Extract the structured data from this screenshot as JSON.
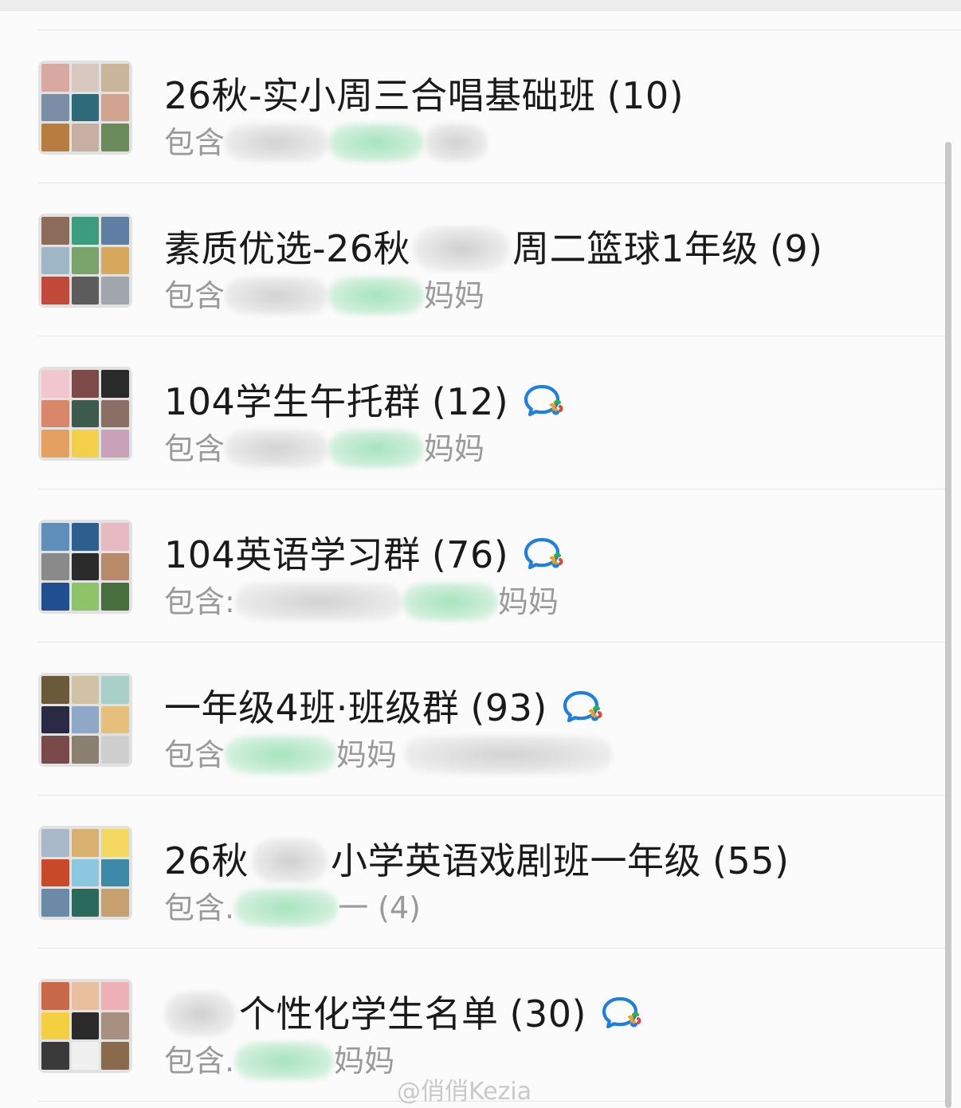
{
  "groups": [
    {
      "title": "26秋-实小周三合唱基础班",
      "count": "(10)",
      "prefix": "包含",
      "suffix": "",
      "tiles": [
        "#d8a9a0",
        "#d9c8c0",
        "#c9b59a",
        "#7a8fa6",
        "#2e6b7a",
        "#d2a48f",
        "#b67d3f",
        "#c7b0a3",
        "#6a8c5b"
      ]
    },
    {
      "title_a": "素质优选-26秋",
      "title_b": "周二篮球1年级",
      "count": "(9)",
      "prefix": "包含",
      "suffix": "妈妈",
      "tiles": [
        "#8b6b5a",
        "#3b9c7e",
        "#5e7fa3",
        "#9fb6c7",
        "#7aa36b",
        "#d7a85a",
        "#c24a3a",
        "#5c5c5c",
        "#9fa7ad"
      ]
    },
    {
      "title": "104学生午托群",
      "count": "(12)",
      "prefix": "包含",
      "suffix": "妈妈",
      "tiles": [
        "#f2c6cf",
        "#7d4b47",
        "#2a2a2a",
        "#d9876b",
        "#3c5a4e",
        "#8c6f64",
        "#e4a060",
        "#f4d04a",
        "#c9a1b9"
      ]
    },
    {
      "title": "104英语学习群",
      "count": "(76)",
      "prefix": "包含:",
      "suffix": "妈妈",
      "tiles": [
        "#5f8fb8",
        "#2d5f8f",
        "#e7b9c2",
        "#8a8a8a",
        "#2b2b2b",
        "#b88a6a",
        "#1f4f8f",
        "#8fc36a",
        "#476e3d"
      ]
    },
    {
      "title": "一年级4班·班级群",
      "count": "(93)",
      "prefix": "包含",
      "suffix": "妈妈",
      "tiles": [
        "#6a5a3a",
        "#d0c2a4",
        "#a8d0c8",
        "#2a2a44",
        "#8fa8c8",
        "#e6c07a",
        "#7a4a4a",
        "#8a8070",
        "#cfcfcf"
      ]
    },
    {
      "title_a": "26秋",
      "title_b": "小学英语戏剧班一年级",
      "count": "(55)",
      "prefix": "包含.",
      "suffix": "一 (4)",
      "tiles": [
        "#a8b8c8",
        "#d8b070",
        "#f4d860",
        "#c84a2a",
        "#8ac8e0",
        "#3a8aa8",
        "#6a8aa8",
        "#2a6a5a",
        "#c8a070"
      ]
    },
    {
      "title": "个性化学生名单",
      "count": "(30)",
      "prefix": "包含.",
      "suffix": "妈妈",
      "tiles": [
        "#c86a4a",
        "#e8c0a0",
        "#f0b0b8",
        "#f4d040",
        "#2a2a2a",
        "#a89080",
        "#3a3a3a",
        "#f0f0f0",
        "#8a6a4a"
      ]
    }
  ],
  "icon_names": [
    "wecom-chat-icon"
  ],
  "watermark": "@俏俏Kezia"
}
